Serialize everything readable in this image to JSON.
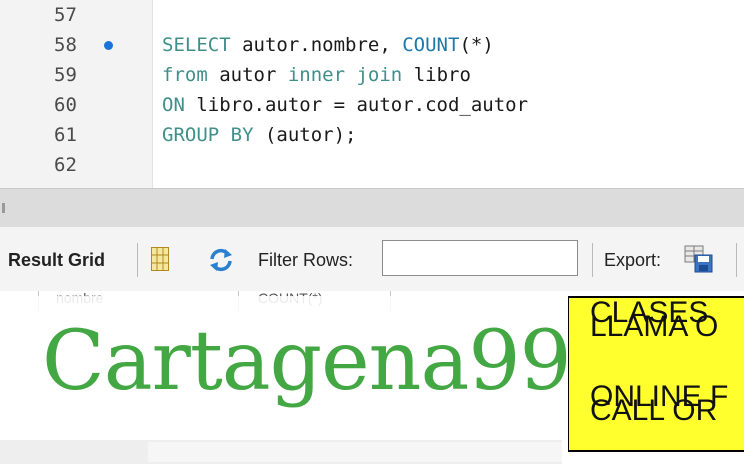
{
  "editor": {
    "lines": [
      {
        "num": "57",
        "tokens": []
      },
      {
        "num": "58",
        "tokens": [
          {
            "t": "SELECT ",
            "c": "kw"
          },
          {
            "t": "autor.nombre, ",
            "c": ""
          },
          {
            "t": "COUNT",
            "c": "fn"
          },
          {
            "t": "(*)",
            "c": ""
          }
        ]
      },
      {
        "num": "59",
        "tokens": [
          {
            "t": "from ",
            "c": "kw"
          },
          {
            "t": "autor ",
            "c": ""
          },
          {
            "t": "inner join ",
            "c": "kw"
          },
          {
            "t": "libro",
            "c": ""
          }
        ]
      },
      {
        "num": "60",
        "tokens": [
          {
            "t": "ON ",
            "c": "kw"
          },
          {
            "t": "libro.autor = autor.cod_autor",
            "c": ""
          }
        ]
      },
      {
        "num": "61",
        "tokens": [
          {
            "t": "GROUP BY ",
            "c": "kw"
          },
          {
            "t": "(autor);",
            "c": ""
          }
        ]
      },
      {
        "num": "62",
        "tokens": []
      }
    ]
  },
  "toolbar": {
    "result_grid_label": "Result Grid",
    "filter_rows_label": "Filter Rows:",
    "filter_value": "",
    "export_label": "Export:"
  },
  "grid": {
    "col1": "nombre",
    "col2": "COUNT(*)"
  },
  "watermark": {
    "logo_text": "Cartagena99",
    "box_lines": [
      "CLASES",
      "LLAMA O",
      "ONLINE F",
      "CALL OR"
    ]
  },
  "colors": {
    "keyword": "#3f8f8a",
    "function": "#1f78a8",
    "breakpoint_dot": "#1a73d9",
    "logo": "#43a843",
    "ad_box": "#ffff2e"
  }
}
